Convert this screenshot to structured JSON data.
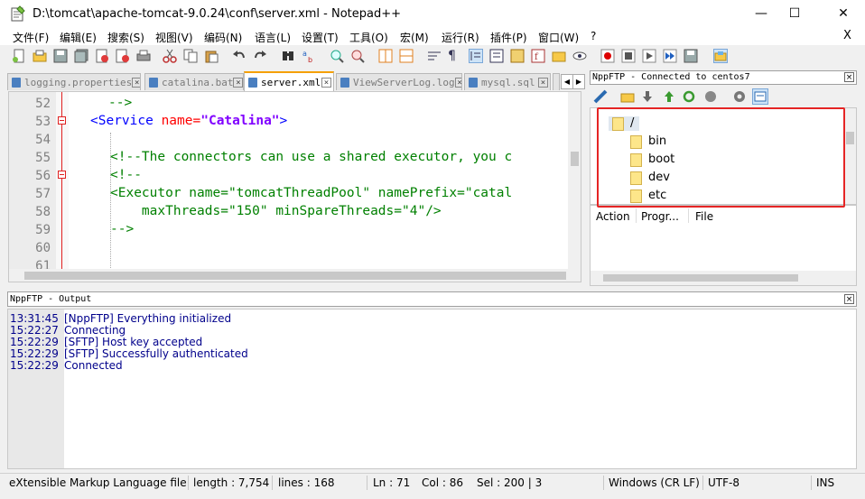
{
  "window": {
    "title": "D:\\tomcat\\apache-tomcat-9.0.24\\conf\\server.xml - Notepad++",
    "minimize": "—",
    "maximize": "☐",
    "close": "✕"
  },
  "menu": {
    "items": [
      "文件(F)",
      "编辑(E)",
      "搜索(S)",
      "视图(V)",
      "编码(N)",
      "语言(L)",
      "设置(T)",
      "工具(O)",
      "宏(M)",
      "运行(R)",
      "插件(P)",
      "窗口(W)",
      "?"
    ],
    "close": "X"
  },
  "tabs": [
    {
      "label": "logging.properties"
    },
    {
      "label": "catalina.bat"
    },
    {
      "label": "server.xml"
    },
    {
      "label": "ViewServerLog.log"
    },
    {
      "label": "mysql.sql"
    }
  ],
  "tab_nav": {
    "prev": "◀",
    "next": "▶"
  },
  "editor": {
    "line_numbers": [
      "52",
      "53",
      "54",
      "55",
      "56",
      "57",
      "58",
      "59",
      "60",
      "61"
    ],
    "lines": {
      "l52": "-->",
      "l53_open": "<",
      "l53_tag": "Service",
      "l53_attr": " name=",
      "l53_val": "\"Catalina\"",
      "l53_close": ">",
      "l55": "<!--The connectors can use a shared executor, you c",
      "l56": "<!--",
      "l57": "<Executor name=\"tomcatThreadPool\" namePrefix=\"catal",
      "l58": "    maxThreads=\"150\" minSpareThreads=\"4\"/>",
      "l59": "-->"
    }
  },
  "ftp": {
    "title": "NppFTP - Connected to centos7",
    "tree": {
      "root": "/",
      "items": [
        "bin",
        "boot",
        "dev",
        "etc"
      ]
    },
    "columns": [
      "Action",
      "Progr...",
      "File"
    ]
  },
  "output": {
    "title": "NppFTP - Output",
    "lines": [
      {
        "time": "13:31:45",
        "msg": "[NppFTP] Everything initialized"
      },
      {
        "time": "15:22:27",
        "msg": "Connecting"
      },
      {
        "time": "15:22:29",
        "msg": "[SFTP] Host key accepted"
      },
      {
        "time": "15:22:29",
        "msg": "[SFTP] Successfully authenticated"
      },
      {
        "time": "15:22:29",
        "msg": "Connected"
      }
    ]
  },
  "status": {
    "type": "eXtensible Markup Language file",
    "length": "length : 7,754",
    "lines": "lines : 168",
    "ln": "Ln : 71",
    "col": "Col : 86",
    "sel": "Sel : 200 | 3",
    "eol": "Windows (CR LF)",
    "encoding": "UTF-8",
    "mode": "INS"
  },
  "close_glyph": "×",
  "colors": {
    "highlight": "#e52525",
    "tab_active_accent": "#f5a000"
  }
}
